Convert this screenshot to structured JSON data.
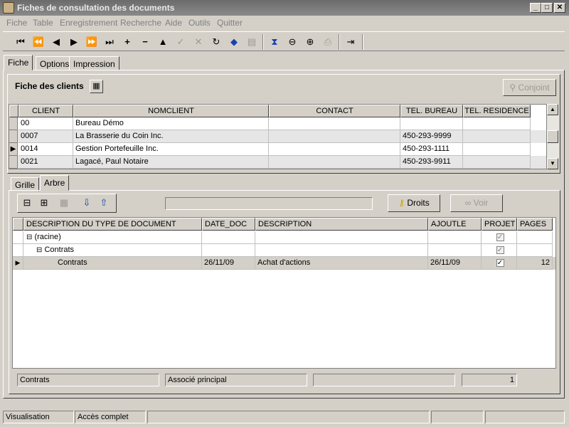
{
  "window": {
    "title": "Fiches de consultation des documents"
  },
  "menu": [
    "Fiche",
    "Table",
    "Enregistrement",
    "Recherche",
    "Aide",
    "Outils",
    "Quitter"
  ],
  "toolbar": {
    "icons": [
      "first-icon",
      "prev-page-icon",
      "prev-icon",
      "next-icon",
      "next-page-icon",
      "last-icon",
      "add-icon",
      "remove-icon",
      "up-icon",
      "confirm-icon",
      "cancel-icon",
      "refresh-icon",
      "tag-icon",
      "disk-icon",
      "hourglass-icon",
      "zoom-out-icon",
      "zoom-in-icon",
      "print-icon",
      "exit-door-icon"
    ]
  },
  "main_tabs": [
    "Fiche",
    "Options",
    "Impression"
  ],
  "clients_panel": {
    "title": "Fiche des clients",
    "conjoint_button": "Conjoint",
    "columns": [
      "CLIENT",
      "NOMCLIENT",
      "CONTACT",
      "TEL. BUREAU",
      "TEL. RESIDENCE"
    ],
    "rows": [
      {
        "client": "00",
        "nom": "Bureau Démo",
        "contact": "",
        "tel_bureau": "",
        "tel_residence": ""
      },
      {
        "client": "0007",
        "nom": "La Brasserie du Coin Inc.",
        "contact": "",
        "tel_bureau": "450-293-9999",
        "tel_residence": ""
      },
      {
        "client": "0014",
        "nom": "Gestion Portefeuille Inc.",
        "contact": "",
        "tel_bureau": "450-293-1111",
        "tel_residence": ""
      },
      {
        "client": "0021",
        "nom": "Lagacé, Paul Notaire",
        "contact": "",
        "tel_bureau": "450-293-9911",
        "tel_residence": ""
      }
    ],
    "selected_row": 2
  },
  "sub_tabs": [
    "Grille",
    "Arbre"
  ],
  "doc_panel": {
    "droits_button": "Droits",
    "voir_button": "Voir",
    "columns": [
      "DESCRIPTION DU TYPE DE DOCUMENT",
      "DATE_DOC",
      "DESCRIPTION",
      "AJOUTLE",
      "PROJET",
      "PAGES"
    ],
    "rows": [
      {
        "desc_type": "(racine)",
        "date_doc": "",
        "description": "",
        "ajoutle": "",
        "projet": true,
        "pages": ""
      },
      {
        "desc_type": "Contrats",
        "date_doc": "",
        "description": "",
        "ajoutle": "",
        "projet": true,
        "pages": ""
      },
      {
        "desc_type": "Contrats",
        "date_doc": "26/11/09",
        "description": "Achat d'actions",
        "ajoutle": "26/11/09",
        "projet": true,
        "pages": "12"
      }
    ],
    "footer": {
      "field1": "Contrats",
      "field2": "Associé principal",
      "field3": "",
      "field4": "1"
    }
  },
  "statusbar": {
    "mode": "Visualisation",
    "access": "Accès complet"
  }
}
